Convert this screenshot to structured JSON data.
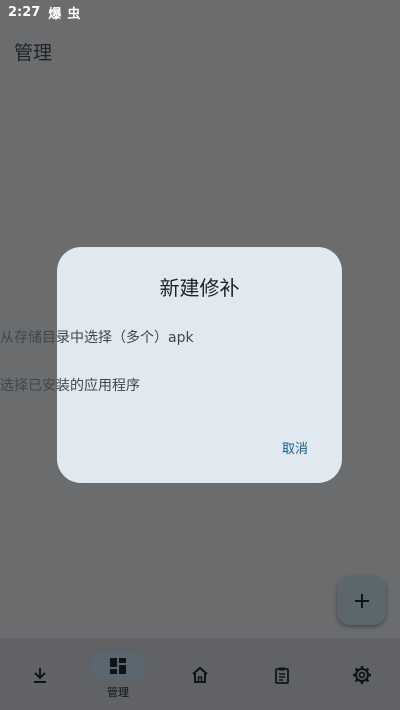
{
  "status_bar": {
    "time": "2:27",
    "notif1": "爆",
    "notif2": "虫"
  },
  "header": {
    "title": "管理"
  },
  "dialog": {
    "title": "新建修补",
    "option1": "从存储目录中选择（多个）apk",
    "option2": "选择已安装的应用程序",
    "cancel": "取消"
  },
  "fab": {
    "icon": "+",
    "icon_name": "add-icon"
  },
  "bottom_nav": {
    "items": [
      {
        "icon": "download-icon",
        "label": ""
      },
      {
        "icon": "dashboard-icon",
        "label": "管理",
        "active": true
      },
      {
        "icon": "home-icon",
        "label": ""
      },
      {
        "icon": "clipboard-icon",
        "label": ""
      },
      {
        "icon": "settings-icon",
        "label": ""
      }
    ]
  },
  "colors": {
    "scrim_background": "#6b6c6d",
    "dialog_background": "#e0e9ef",
    "accent": "#1b5d86",
    "fab_background": "#5c666d",
    "bottom_nav_background": "#606265"
  }
}
